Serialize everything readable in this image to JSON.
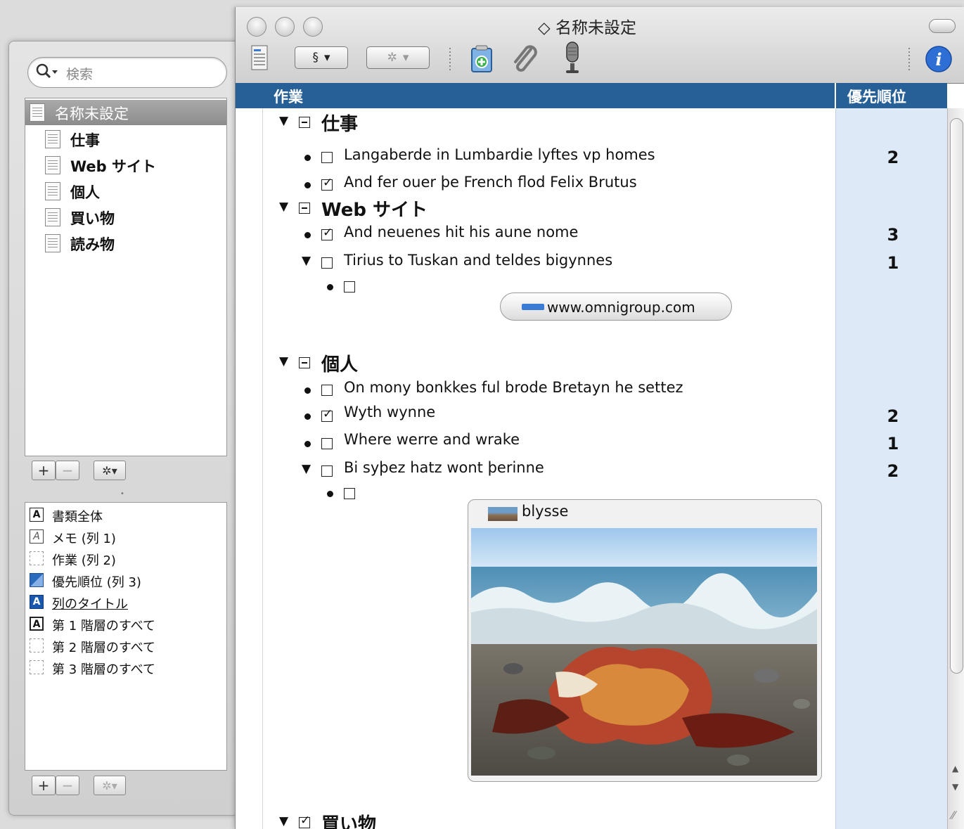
{
  "window": {
    "title": "名称未設定",
    "title_prefix": "◇"
  },
  "drawer": {
    "search_placeholder": "検索",
    "documents": [
      {
        "label": "名称未設定",
        "selected": true
      },
      {
        "label": "仕事"
      },
      {
        "label": "Web サイト"
      },
      {
        "label": "個人"
      },
      {
        "label": "買い物"
      },
      {
        "label": "読み物"
      }
    ],
    "add_label": "+",
    "remove_label": "−",
    "gear_label": "✲▾",
    "styles": [
      {
        "label": "書類全体",
        "icon": "A"
      },
      {
        "label": "メモ (列 1)",
        "icon": "A"
      },
      {
        "label": "作業 (列 2)",
        "icon": ""
      },
      {
        "label": "優先順位 (列 3)",
        "icon": ""
      },
      {
        "label": "列のタイトル",
        "icon": "A"
      },
      {
        "label": "第 1 階層のすべて",
        "icon": "A"
      },
      {
        "label": "第 2 階層のすべて",
        "icon": ""
      },
      {
        "label": "第 3 階層のすべて",
        "icon": ""
      }
    ]
  },
  "toolbar": {
    "section_label": "§",
    "dropdown_label": "▾",
    "gear_label": "✲"
  },
  "columns": {
    "task": "作業",
    "priority": "優先順位"
  },
  "outline": {
    "work": {
      "title": "仕事"
    },
    "work_items": [
      {
        "text": "Langaberde in Lumbardie lyftes vp homes",
        "checked": false,
        "priority": "2"
      },
      {
        "text": "And fer ouer þe French flod Felix Brutus",
        "checked": true,
        "priority": ""
      }
    ],
    "web": {
      "title": "Web サイト"
    },
    "web_items": [
      {
        "text": "And neuenes hit his aune nome",
        "checked": true,
        "priority": "3"
      },
      {
        "text": "Tirius to Tuskan and teldes bigynnes",
        "checked": false,
        "priority": "1"
      }
    ],
    "url": "www.omnigroup.com",
    "personal": {
      "title": "個人"
    },
    "personal_items": [
      {
        "text": "On mony bonkkes ful brode Bretayn he settez",
        "checked": false,
        "priority": ""
      },
      {
        "text": "Wyth wynne",
        "checked": true,
        "priority": "2"
      },
      {
        "text": "Where werre and wrake",
        "checked": false,
        "priority": "1"
      },
      {
        "text": "Bi syþez hatz wont þerinne",
        "checked": false,
        "priority": "2"
      }
    ],
    "image_caption": "blysse",
    "shopping": {
      "title": "買い物"
    }
  }
}
